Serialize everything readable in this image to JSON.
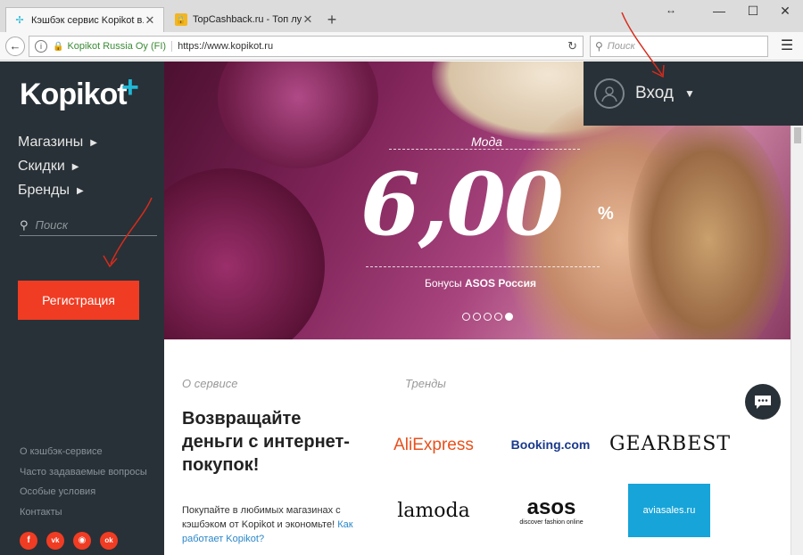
{
  "browser": {
    "tabs": [
      {
        "title": "Кэшбэк сервис Kopikot в...",
        "favicon": "kopikot-icon",
        "active": true
      },
      {
        "title": "TopCashback.ru - Топ лу...",
        "favicon": "lock-icon",
        "active": false
      }
    ],
    "new_tab": "+",
    "window_controls": {
      "minimize": "—",
      "maximize": "☐",
      "close": "✕"
    },
    "identity": "Kopikot Russia Oy (FI)",
    "url": "https://www.kopikot.ru",
    "search_placeholder": "Поиск"
  },
  "sidebar": {
    "logo": "Kopikot",
    "logo_plus": "+",
    "nav": [
      {
        "label": "Магазины"
      },
      {
        "label": "Скидки"
      },
      {
        "label": "Бренды"
      }
    ],
    "search_placeholder": "Поиск",
    "register_label": "Регистрация",
    "footer_links": [
      {
        "label": "О кэшбэк-сервисе"
      },
      {
        "label": "Часто задаваемые вопросы"
      },
      {
        "label": "Особые условия"
      },
      {
        "label": "Контакты"
      }
    ],
    "social": [
      "facebook-icon",
      "vk-icon",
      "instagram-icon",
      "ok-icon"
    ]
  },
  "hero": {
    "category": "Мода",
    "cashback_value": "6,00",
    "percent": "%",
    "bonus_prefix": "Бонусы",
    "store": "ASOS Россия",
    "slides_count": 5,
    "active_slide": 5
  },
  "login": {
    "label": "Вход"
  },
  "content": {
    "about_label": "О сервисе",
    "trends_label": "Тренды",
    "headline": "Возвращайте деньги с интернет-покупок!",
    "description": "Покупайте в любимых магазинах с кэшбэком от Kopikot и экономьте!",
    "how_link": "Как работает Kopikot?",
    "brands": [
      {
        "name": "AliExpress"
      },
      {
        "name": "Booking.com"
      },
      {
        "name": "GEARBEST"
      },
      {
        "name": "lamoda"
      },
      {
        "name": "asos",
        "tagline": "discover fashion online"
      },
      {
        "name": "aviasales.ru"
      }
    ]
  },
  "colors": {
    "sidebar": "#283137",
    "accent": "#f03c23",
    "logo_plus": "#1fb8d7",
    "arrows": "#d92b1c"
  }
}
